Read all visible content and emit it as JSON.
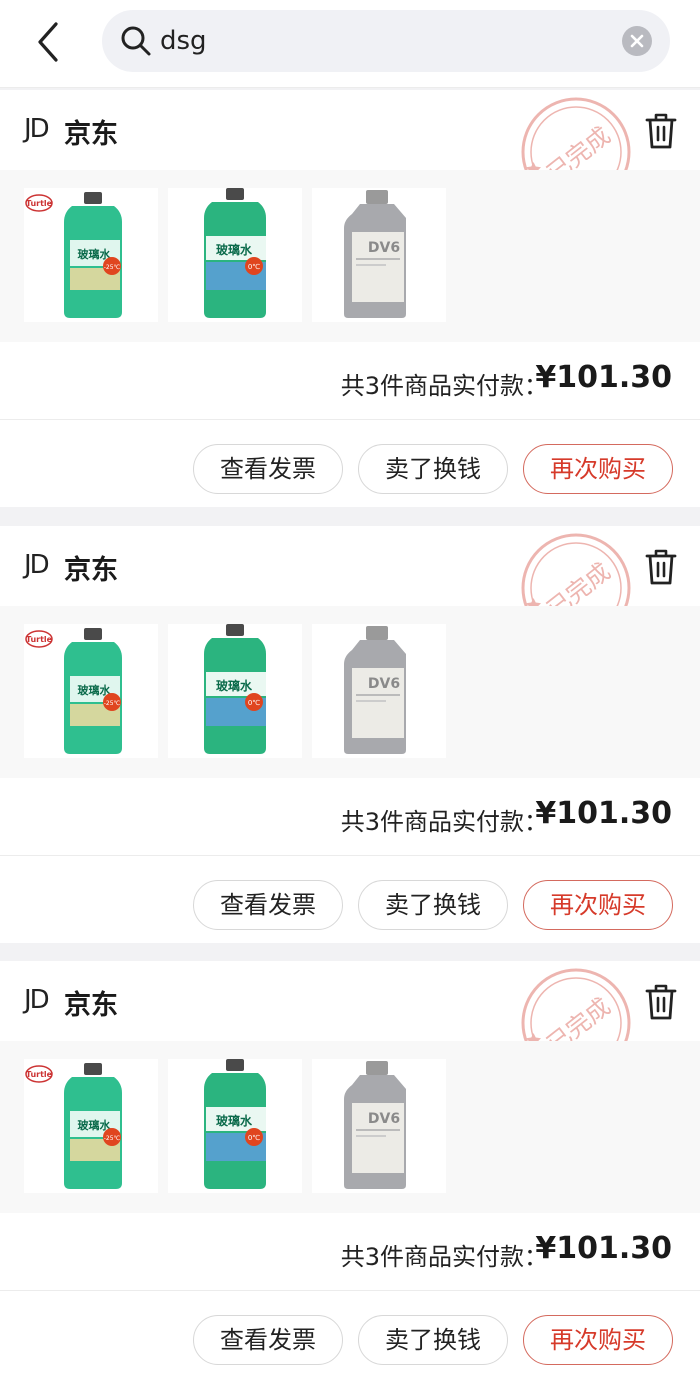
{
  "search": {
    "query": "dsg"
  },
  "orders": [
    {
      "shop_logo": "JD",
      "shop_name": "京东",
      "stamp": "已完成",
      "product_count": "共3件商品",
      "pay_label": "实付款：",
      "amount": "¥101.30",
      "buttons": {
        "invoice": "查看发票",
        "sell": "卖了换钱",
        "rebuy": "再次购买"
      }
    },
    {
      "shop_logo": "JD",
      "shop_name": "京东",
      "stamp": "已完成",
      "product_count": "共3件商品",
      "pay_label": "实付款：",
      "amount": "¥101.30",
      "buttons": {
        "invoice": "查看发票",
        "sell": "卖了换钱",
        "rebuy": "再次购买"
      }
    },
    {
      "shop_logo": "JD",
      "shop_name": "京东",
      "stamp": "已完成",
      "product_count": "共3件商品",
      "pay_label": "实付款：",
      "amount": "¥101.30",
      "buttons": {
        "invoice": "查看发票",
        "sell": "卖了换钱",
        "rebuy": "再次购买"
      }
    }
  ],
  "product_labels": {
    "turtle_brand": "Turtle",
    "glass_water": "玻璃水",
    "temp_25": "-25℃",
    "temp_0": "0℃",
    "oil_brand": "DV6"
  },
  "colors": {
    "accent_red": "#d63a2a",
    "stamp_red": "#e07a70",
    "bottle_green": "#2fbf8f"
  }
}
